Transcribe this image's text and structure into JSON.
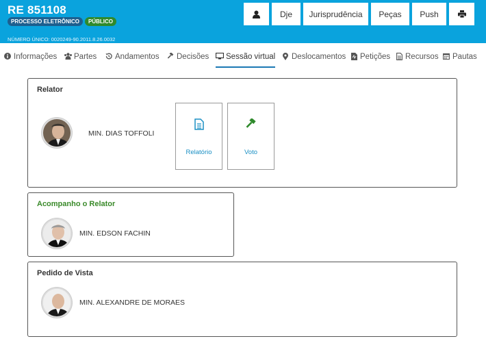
{
  "header": {
    "case_title": "RE 851108",
    "badge_process": "PROCESSO ELETRÔNICO",
    "badge_public": "PÚBLICO",
    "unique_number": "NÚMERO ÚNICO: 0020249-90.2011.8.26.0032",
    "background_color": "#0aa3dd"
  },
  "top_buttons": {
    "user_icon": "user-icon",
    "dje": "Dje",
    "jurisprudencia": "Jurisprudência",
    "pecas": "Peças",
    "push": "Push",
    "print_icon": "print-icon"
  },
  "tabs": [
    {
      "label": "Informações",
      "icon": "info-icon"
    },
    {
      "label": "Partes",
      "icon": "users-icon"
    },
    {
      "label": "Andamentos",
      "icon": "history-icon"
    },
    {
      "label": "Decisões",
      "icon": "gavel-icon"
    },
    {
      "label": "Sessão virtual",
      "icon": "monitor-icon",
      "active": true
    },
    {
      "label": "Deslocamentos",
      "icon": "map-marker-icon"
    },
    {
      "label": "Petições",
      "icon": "pdf-icon"
    },
    {
      "label": "Recursos",
      "icon": "document-icon"
    },
    {
      "label": "Pautas",
      "icon": "calendar-icon"
    }
  ],
  "relator": {
    "title": "Relator",
    "minister": "MIN. DIAS TOFFOLI",
    "tiles": [
      {
        "label": "Relatório",
        "icon": "document-icon"
      },
      {
        "label": "Voto",
        "icon": "gavel-icon"
      }
    ]
  },
  "acompanho": {
    "title": "Acompanho o Relator",
    "title_color": "#3a8a2a",
    "minister": "MIN. EDSON FACHIN"
  },
  "vista": {
    "title": "Pedido de Vista",
    "minister": "MIN. ALEXANDRE DE MORAES"
  }
}
